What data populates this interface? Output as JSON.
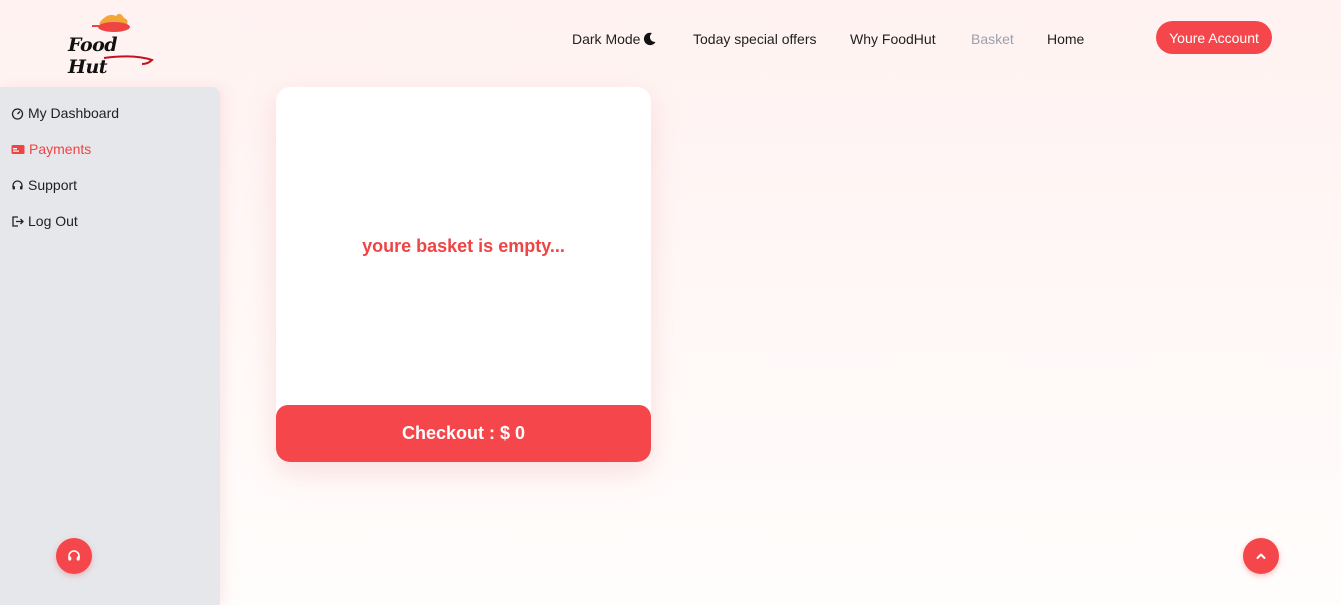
{
  "brand": {
    "name": "Food Hut"
  },
  "nav": {
    "dark_mode": "Dark Mode",
    "offers": "Today special offers",
    "why": "Why FoodHut",
    "basket": "Basket",
    "home": "Home",
    "account": "Youre Account"
  },
  "sidebar": {
    "items": [
      {
        "label": "My Dashboard",
        "icon": "gauge-icon"
      },
      {
        "label": "Payments",
        "icon": "credit-card-icon"
      },
      {
        "label": "Support",
        "icon": "headset-icon"
      },
      {
        "label": "Log Out",
        "icon": "logout-icon"
      }
    ]
  },
  "basket": {
    "empty_message": "youre basket is empty...",
    "checkout_label": "Checkout : $ 0"
  },
  "colors": {
    "accent": "#f5474b",
    "accent_text": "#ef4444",
    "sidebar_bg": "#e5e7eb",
    "active_nav": "#9aa0ad"
  }
}
